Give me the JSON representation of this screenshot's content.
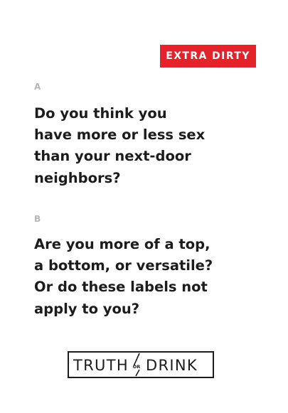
{
  "badge": {
    "label": "EXTRA DIRTY",
    "color": "#e3222b"
  },
  "question_a": {
    "label": "A",
    "lines": [
      "Do you think you",
      "have more or less sex",
      "than your next-door",
      "neighbors?"
    ]
  },
  "question_b": {
    "label": "B",
    "lines": [
      "Are you more of a top,",
      "a bottom, or versatile?",
      "Or do these labels not",
      "apply to you?"
    ]
  },
  "logo": {
    "left_word": "TRUTH",
    "connector": "OR",
    "right_word": "DRINK"
  }
}
